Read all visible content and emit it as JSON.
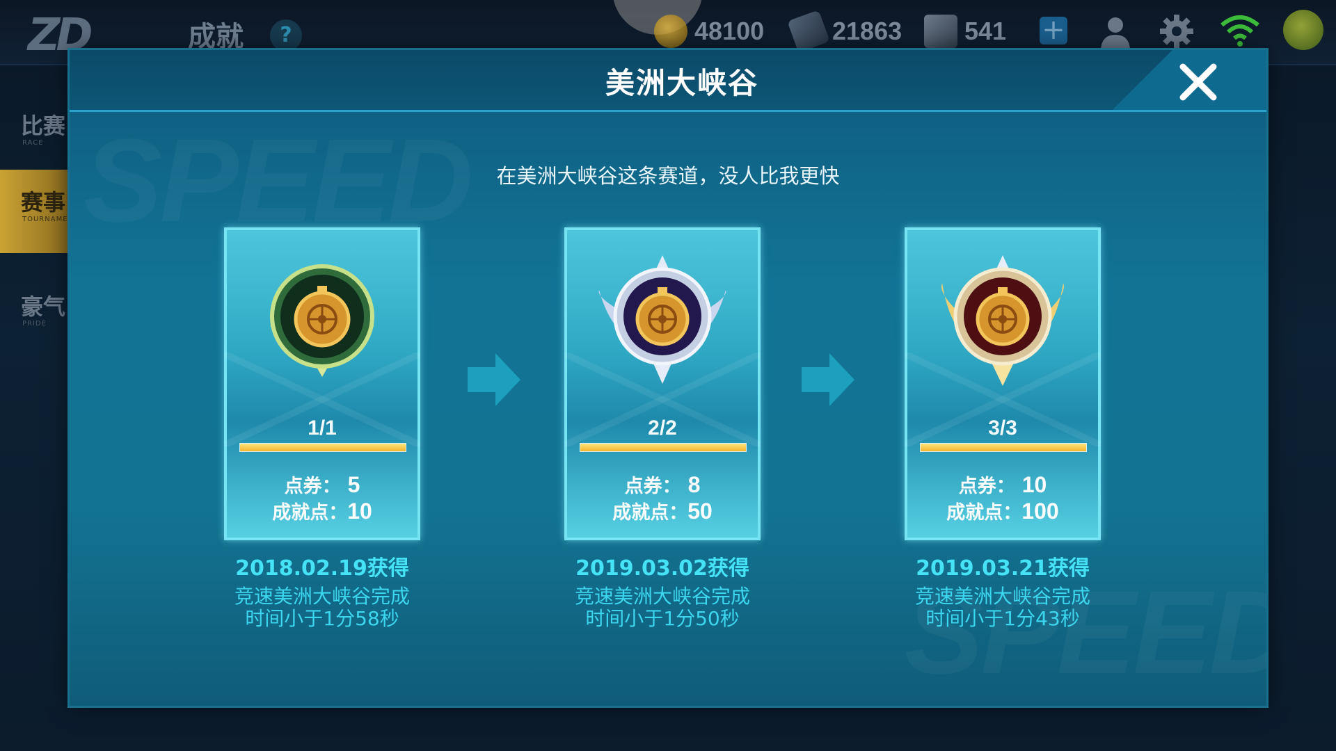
{
  "topbar": {
    "page_title": "成就",
    "help_label": "?",
    "resources": [
      {
        "icon": "gold-coin-icon",
        "value": "48100"
      },
      {
        "icon": "voucher-icon",
        "value": "21863"
      },
      {
        "icon": "diamond-icon",
        "value": "541"
      }
    ],
    "plus_label": "+"
  },
  "sidebar": {
    "tabs": [
      {
        "label": "比赛",
        "sub": "RACE",
        "active": false
      },
      {
        "label": "赛事",
        "sub": "TOURNAMENT",
        "active": true
      },
      {
        "label": "豪气",
        "sub": "PRIDE",
        "active": false
      }
    ]
  },
  "modal": {
    "title": "美洲大峡谷",
    "subtitle": "在美洲大峡谷这条赛道，没人比我更快",
    "watermark": "SPEED",
    "cards": [
      {
        "medal": "green-stopwatch-medal-icon",
        "progress_text": "1/1",
        "progress": 1.0,
        "voucher_label": "点券：",
        "voucher_value": "5",
        "points_label": "成就点：",
        "points_value": "10",
        "date": "2018.02.19获得",
        "desc_line1": "竞速美洲大峡谷完成",
        "desc_line2": "时间小于1分58秒"
      },
      {
        "medal": "purple-winged-stopwatch-medal-icon",
        "progress_text": "2/2",
        "progress": 1.0,
        "voucher_label": "点券：",
        "voucher_value": "8",
        "points_label": "成就点：",
        "points_value": "50",
        "date": "2019.03.02获得",
        "desc_line1": "竞速美洲大峡谷完成",
        "desc_line2": "时间小于1分50秒"
      },
      {
        "medal": "red-gold-winged-stopwatch-medal-icon",
        "progress_text": "3/3",
        "progress": 1.0,
        "voucher_label": "点券：",
        "voucher_value": "10",
        "points_label": "成就点：",
        "points_value": "100",
        "date": "2019.03.21获得",
        "desc_line1": "竞速美洲大峡谷完成",
        "desc_line2": "时间小于1分43秒"
      }
    ]
  },
  "colors": {
    "accent_cyan": "#46e3f6",
    "progress_gold": "#f3b52d",
    "active_tab": "#caa233"
  }
}
